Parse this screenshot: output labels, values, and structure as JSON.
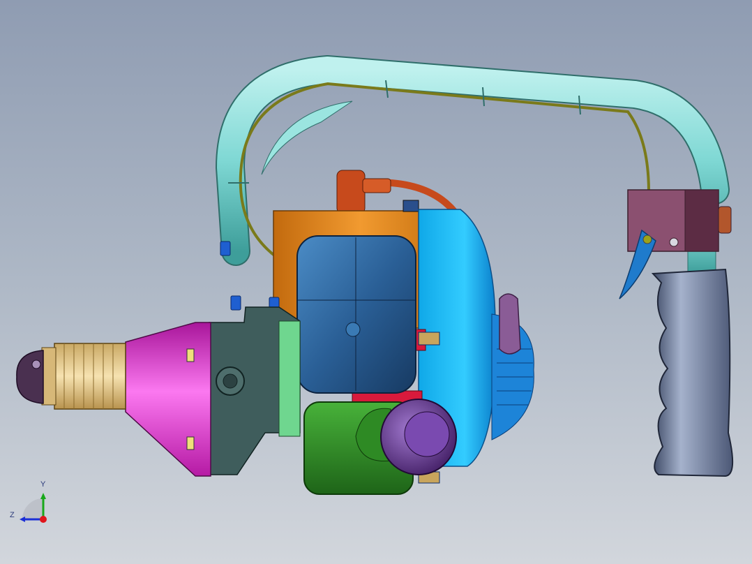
{
  "triad": {
    "y_label": "Y",
    "z_label": "Z",
    "colors": {
      "y_axis": "#18a81a",
      "z_axis": "#1b2fd6",
      "x_axis": "#e0141b"
    }
  },
  "model": {
    "colors": {
      "chuck": "#e4c88c",
      "cone": "#ea30d6",
      "gear_housing": "#3f5d5c",
      "crankcase": "#ec8a1a",
      "fuel_tank": "#2a5f96",
      "fan_cover": "#18b8f2",
      "air_filter": "#2e8a24",
      "handle_tube": "#7fd8d4",
      "throttle_block": "#8b5070",
      "grip": "#6a7898",
      "spark_cap": "#c74a1c",
      "knob": "#5a2a82"
    }
  }
}
